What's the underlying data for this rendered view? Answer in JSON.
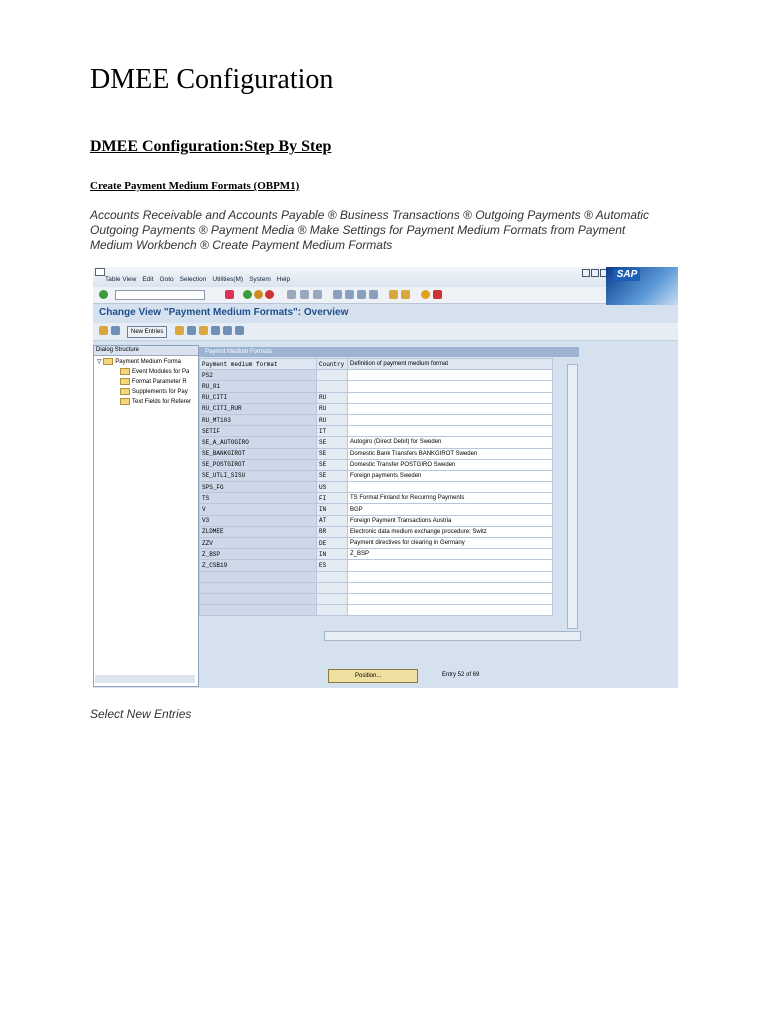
{
  "document": {
    "title": "DMEE Configuration",
    "subtitle": "DMEE Configuration:Step By Step",
    "section_heading": "Create Payment Medium Formats (OBPM1)",
    "menu_path": "Accounts Receivable and Accounts Payable ® Business Transactions ® Outgoing Payments ® Automatic Outgoing Payments ® Payment Media ® Make Settings for Payment Medium Formats from Payment Medium Workbench ® Create Payment Medium Formats",
    "caption": "Select New Entries"
  },
  "sap": {
    "menu": [
      "Table View",
      "Edit",
      "Goto",
      "Selection",
      "Utilities(M)",
      "System",
      "Help"
    ],
    "logo": "SAP",
    "screen_title": "Change View \"Payment Medium Formats\": Overview",
    "new_entries_label": "New Entries",
    "dialog_structure": {
      "header": "Dialog Structure",
      "items": [
        {
          "label": "Payment Medium Forma",
          "level": 0
        },
        {
          "label": "Event Modules for Pa",
          "level": 1
        },
        {
          "label": "Format Parameter R",
          "level": 1
        },
        {
          "label": "Supplements for Pay",
          "level": 1
        },
        {
          "label": "Text Fields for Referer",
          "level": 1
        }
      ]
    },
    "table": {
      "caption": "Paymnt Medium Formats",
      "columns": [
        "Payment medium format",
        "Country",
        "Definition of payment medium format"
      ],
      "rows": [
        [
          "PS2",
          "",
          ""
        ],
        [
          "RU_01",
          "",
          ""
        ],
        [
          "RU_CITI",
          "RU",
          ""
        ],
        [
          "RU_CITI_RUR",
          "RU",
          ""
        ],
        [
          "RU_MT103",
          "RU",
          ""
        ],
        [
          "SETIF",
          "IT",
          ""
        ],
        [
          "SE_A_AUTOGIRO",
          "SE",
          "Autogiro (Direct Debit) for Sweden"
        ],
        [
          "SE_BANKGIROT",
          "SE",
          "Domestic Bank Transfers BANKGIROT Sweden"
        ],
        [
          "SE_POSTGIROT",
          "SE",
          "Domestic Transfer POSTGIRO Sweden"
        ],
        [
          "SE_UTLI_SISU",
          "SE",
          "Foreign payments Sweden"
        ],
        [
          "SPS_FG",
          "US",
          ""
        ],
        [
          "TS",
          "FI",
          "TS Format Finland for Recurring Payments"
        ],
        [
          "V",
          "IN",
          "BGP"
        ],
        [
          "V3",
          "AT",
          "Foreign Payment Transactions Austria"
        ],
        [
          "ZLDMEE",
          "BR",
          "Electronic data medium exchange procedure; Switz"
        ],
        [
          "ZZV",
          "DE",
          "Payment directives for clearing in Germany"
        ],
        [
          "Z_BSP",
          "IN",
          "Z_BSP"
        ],
        [
          "Z_CSB19",
          "ES",
          ""
        ],
        [
          "",
          "",
          ""
        ],
        [
          "",
          "",
          ""
        ],
        [
          "",
          "",
          ""
        ],
        [
          "",
          "",
          ""
        ]
      ]
    },
    "position_label": "Position...",
    "entry_text": "Entry 52 of 69"
  }
}
